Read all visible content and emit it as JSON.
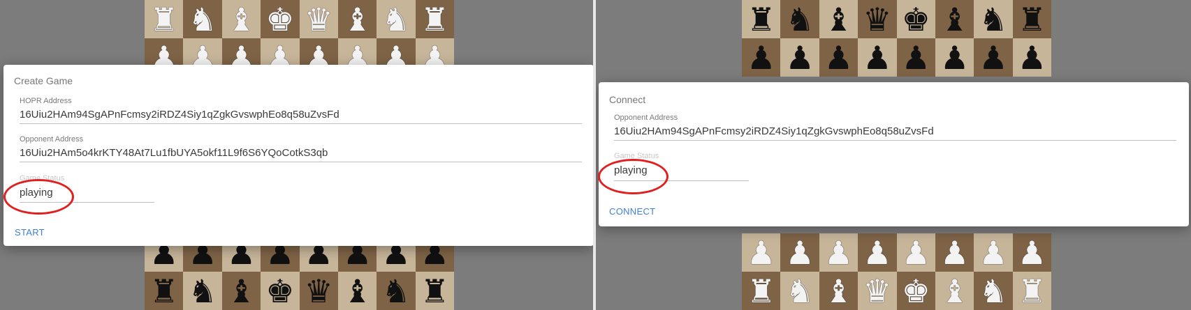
{
  "colors": {
    "accent": "#3f7fd8",
    "highlight_ring": "#e0201f",
    "board_light": "#c7b59a",
    "board_dark": "#7e6346"
  },
  "left_panel": {
    "board_ranks": [
      [
        "♜",
        "♞",
        "♝",
        "♛",
        "♚",
        "♝",
        "♞",
        "♜"
      ],
      [
        "♟",
        "♟",
        "♟",
        "♟",
        "♟",
        "♟",
        "♟",
        "♟"
      ],
      [
        "♟",
        "♟",
        "♟",
        "♟",
        "♟",
        "♟",
        "♟",
        "♟"
      ],
      [
        "♜",
        "♞",
        "♝",
        "♚",
        "♛",
        "♝",
        "♞",
        "♜"
      ]
    ],
    "dialog": {
      "title": "Create Game",
      "hopr_label": "HOPR Address",
      "hopr_value": "16Uiu2HAm94SgAPnFcmsy2iRDZ4Siy1qZgkGvswphEo8q58uZvsFd",
      "opponent_label": "Opponent Address",
      "opponent_value": "16Uiu2HAm5o4krKTY48At7Lu1fbUYA5okf11L9f6S6YQoCotkS3qb",
      "status_label": "Game Status",
      "status_value": "playing",
      "action_label": "START"
    }
  },
  "right_panel": {
    "board_ranks": [
      [
        "♜",
        "♞",
        "♝",
        "♛",
        "♚",
        "♝",
        "♞",
        "♜"
      ],
      [
        "♟",
        "♟",
        "♟",
        "♟",
        "♟",
        "♟",
        "♟",
        "♟"
      ],
      [
        "♟",
        "♟",
        "♟",
        "♟",
        "♟",
        "♟",
        "♟",
        "♟"
      ],
      [
        "♜",
        "♞",
        "♝",
        "♛",
        "♚",
        "♝",
        "♞",
        "♜"
      ]
    ],
    "dialog": {
      "title": "Connect",
      "opponent_label": "Opponent Address",
      "opponent_value": "16Uiu2HAm94SgAPnFcmsy2iRDZ4Siy1qZgkGvswphEo8q58uZvsFd",
      "status_label": "Game Status",
      "status_value": "playing",
      "action_label": "CONNECT"
    }
  }
}
